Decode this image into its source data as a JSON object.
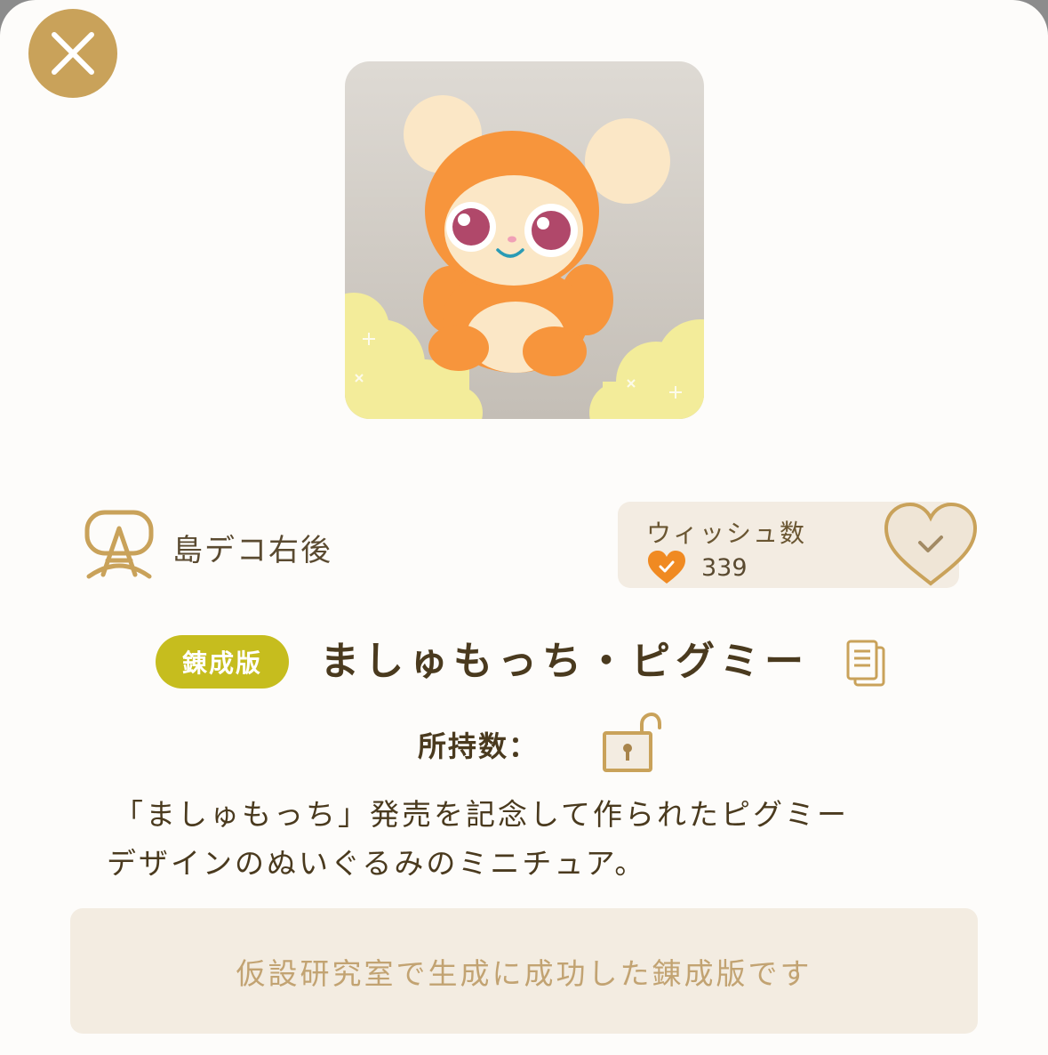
{
  "close_button": {
    "icon": "close-icon"
  },
  "item": {
    "image_alt": "ましゅもっち・ピグミー",
    "badge": "錬成版",
    "name": "ましゅもっち・ピグミー",
    "owned_label": "所持数："
  },
  "owner": {
    "icon": "island-owner-icon",
    "name": "島デコ右後"
  },
  "wish": {
    "label": "ウィッシュ数",
    "count": "339"
  },
  "description": {
    "line1": "「ましゅもっち」発売を記念して作られたピグミー",
    "line2": "デザインのぬいぐるみのミニチュア。"
  },
  "notice": "仮設研究室で生成に成功した錬成版です",
  "colors": {
    "accent_gold": "#c9a25a",
    "badge_yellow": "#c6bd1e",
    "heart_orange": "#f08a22",
    "text_brown": "#4a3a1e"
  }
}
